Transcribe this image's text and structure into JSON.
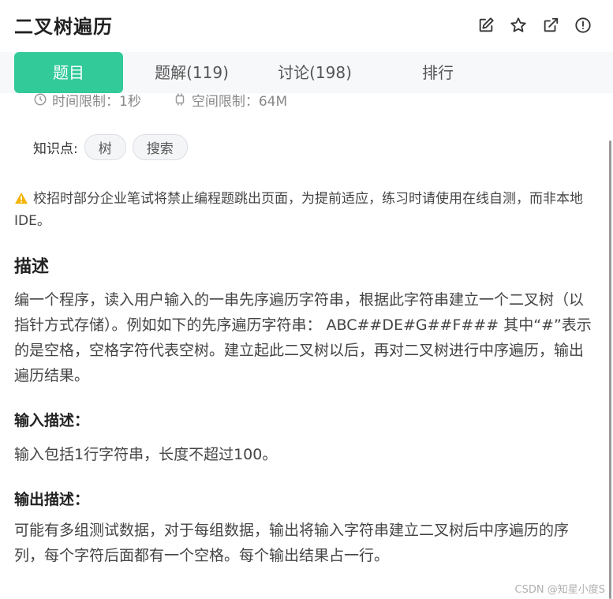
{
  "header": {
    "title": "二叉树遍历",
    "icons": [
      "edit-icon",
      "star-icon",
      "external-link-icon",
      "info-icon"
    ]
  },
  "tabs": [
    {
      "label": "题目",
      "active": true
    },
    {
      "label": "题解(119)",
      "active": false
    },
    {
      "label": "讨论(198)",
      "active": false
    },
    {
      "label": "排行",
      "active": false
    }
  ],
  "limits": {
    "time": "时间限制：1秒",
    "memory": "空间限制：64M"
  },
  "knowledge": {
    "label": "知识点:",
    "tags": [
      "树",
      "搜索"
    ]
  },
  "warning": {
    "text": "校招时部分企业笔试将禁止编程题跳出页面，为提前适应，练习时请使用在线自测，而非本地IDE。"
  },
  "description": {
    "heading": "描述",
    "text": "编一个程序，读入用户输入的一串先序遍历字符串，根据此字符串建立一个二叉树（以指针方式存储）。例如如下的先序遍历字符串： ABC##DE#G##F### 其中“#”表示的是空格，空格字符代表空树。建立起此二叉树以后，再对二叉树进行中序遍历，输出遍历结果。"
  },
  "input": {
    "heading": "输入描述：",
    "text": "输入包括1行字符串，长度不超过100。"
  },
  "output": {
    "heading": "输出描述：",
    "text": "可能有多组测试数据，对于每组数据，输出将输入字符串建立二叉树后中序遍历的序列，每个字符后面都有一个空格。每个输出结果占一行。"
  },
  "watermark": "CSDN @知星小度S",
  "colors": {
    "accent": "#32ca99",
    "warning": "#f5b400"
  }
}
